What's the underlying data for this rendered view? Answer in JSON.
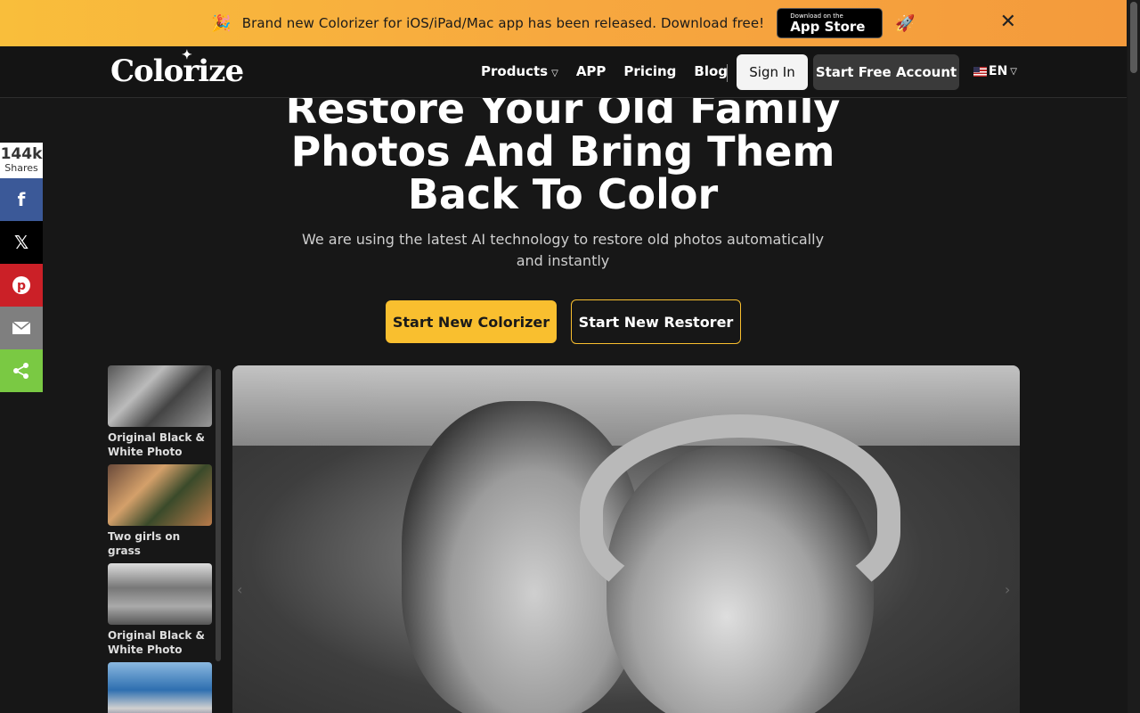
{
  "promo": {
    "message": "Brand new Colorizer for iOS/iPad/Mac app has been released. Download free!",
    "appstore_small": "Download on the",
    "appstore_big": "App Store",
    "party_icon": "🎉",
    "rocket_icon": "🚀",
    "close_icon": "✕"
  },
  "nav": {
    "logo": "Colorize",
    "links": [
      "Products",
      "APP",
      "Pricing",
      "Blog"
    ],
    "signin": "Sign In",
    "start_account": "Start Free Account",
    "language": "EN"
  },
  "hero": {
    "title": "Restore Your Old Family Photos And Bring Them Back To Color",
    "subtitle": "We are using the latest AI technology to restore old photos automatically and instantly",
    "btn_colorizer": "Start New Colorizer",
    "btn_restorer": "Start New Restorer"
  },
  "share": {
    "count": "144k",
    "label": "Shares",
    "icons": [
      "facebook-icon",
      "x-icon",
      "pinterest-icon",
      "email-icon",
      "share-icon"
    ]
  },
  "thumbs": [
    {
      "caption": "Original Black & White Photo"
    },
    {
      "caption": "Two girls on grass"
    },
    {
      "caption": "Original Black & White Photo"
    },
    {
      "caption": ""
    }
  ],
  "colors": {
    "accent": "#f9bf2f",
    "background": "#171717"
  }
}
